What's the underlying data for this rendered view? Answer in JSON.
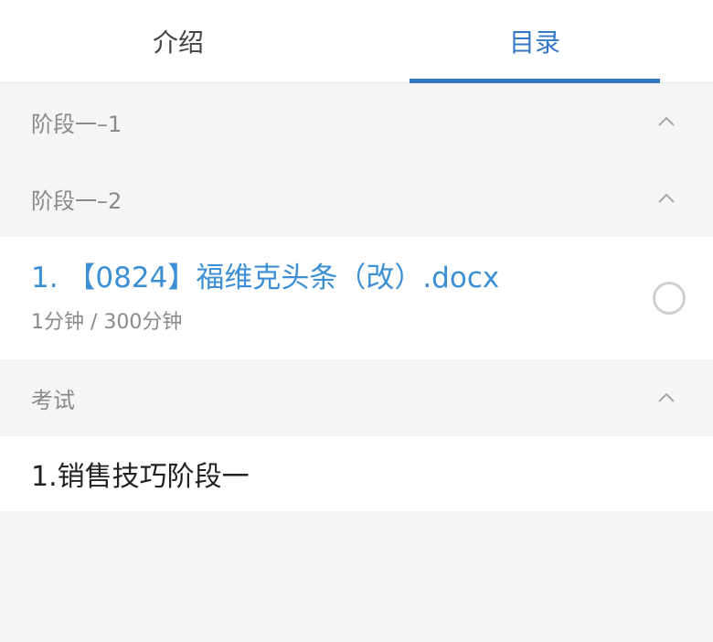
{
  "tabs": [
    {
      "label": "介绍",
      "active": false
    },
    {
      "label": "目录",
      "active": true
    }
  ],
  "sections": [
    {
      "title": "阶段一–1"
    },
    {
      "title": "阶段一–2"
    }
  ],
  "course_item": {
    "title": "1. 【0824】福维克头条（改）.docx",
    "progress": "1分钟 / 300分钟"
  },
  "exam_section": {
    "title": "考试"
  },
  "exam_item": {
    "title": "1.销售技巧阶段一"
  },
  "colors": {
    "accent": "#3478c6",
    "link": "#3c8fd4",
    "muted": "#8a8a8a",
    "background": "#f5f5f5"
  },
  "icons": {
    "collapse": "chevron-up-icon",
    "status": "radio-circle-icon"
  }
}
